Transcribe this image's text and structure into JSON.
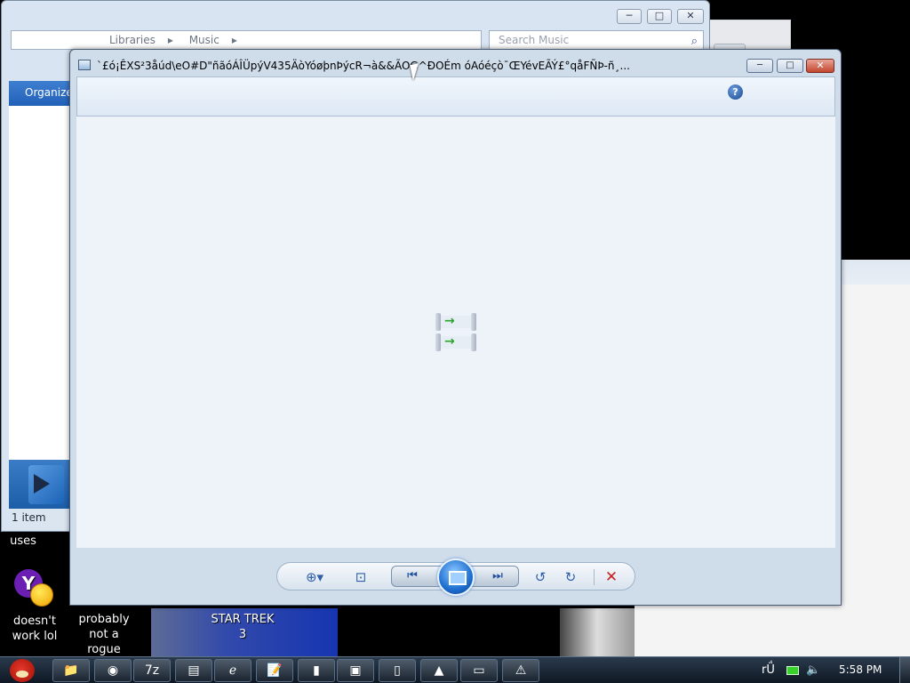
{
  "explorer": {
    "breadcrumb": [
      "Libraries",
      "Music"
    ],
    "search_placeholder": "Search Music",
    "toolbar_label": "Organize",
    "status": "1 item",
    "buttons": {
      "minimize": "─",
      "maximize": "□",
      "close": "✕"
    }
  },
  "viewer": {
    "title": "`£ó¡ÊXS²3åúd\\eO#D\"ñãóÁÎÜpýV435ÄòYóøþnÞýcR¬à&&ÃOG^ÐOÉm óAóéçò¯ŒYévEÃÝ£°qåFÑÞ-ñ¸...",
    "buttons": {
      "minimize": "─",
      "maximize": "□",
      "close": "✕"
    },
    "help_label": "?",
    "controls": {
      "zoom": "⊕▾",
      "actual_size": "⊡",
      "previous": "⏮",
      "next": "⏭",
      "rotate_ccw": "↺",
      "rotate_cw": "↻",
      "delete": "✕"
    }
  },
  "desktop": {
    "icons": [
      {
        "label": "uses"
      },
      {
        "label": "doesn't work lol"
      },
      {
        "label": "probably not a rogue"
      },
      {
        "label": "STAR TREK 3"
      }
    ]
  },
  "taskbar": {
    "apps": [
      "folder-icon",
      "chrome-icon",
      "7zip-icon",
      "winrar-icon",
      "ie-icon",
      "notepad-icon",
      "book-icon",
      "photo-viewer-icon",
      "document-icon",
      "vlc-icon",
      "window-icon",
      "warning-icon"
    ],
    "app_glyphs": [
      "📁",
      "◉",
      "7z",
      "▤",
      "ℯ",
      "📝",
      "▮",
      "▣",
      "▯",
      "▲",
      "▭",
      "⚠"
    ],
    "tray_text": "rǗ",
    "time": "5:58 PM"
  }
}
